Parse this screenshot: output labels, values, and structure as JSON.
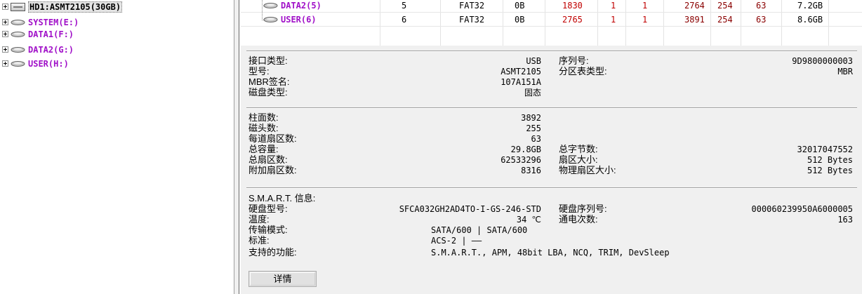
{
  "tree": {
    "disk_label": "HD1:ASMT2105(30GB)",
    "partitions": [
      "SYSTEM(E:)",
      "DATA1(F:)",
      "DATA2(G:)",
      "USER(H:)"
    ]
  },
  "partition_table": {
    "rows": [
      {
        "name": "DATA2(5)",
        "index": "5",
        "fs": "FAT32",
        "id": "0B",
        "start_cyl": "1830",
        "start_head": "1",
        "start_sector": "1",
        "end_cyl": "2764",
        "end_head": "254",
        "end_sector": "63",
        "size": "7.2GB"
      },
      {
        "name": "USER(6)",
        "index": "6",
        "fs": "FAT32",
        "id": "0B",
        "start_cyl": "2765",
        "start_head": "1",
        "start_sector": "1",
        "end_cyl": "3891",
        "end_head": "254",
        "end_sector": "63",
        "size": "8.6GB"
      }
    ]
  },
  "disk_info": {
    "interface_label": "接口类型:",
    "interface_value": "USB",
    "model_label": "型号:",
    "model_value": "ASMT2105",
    "mbr_sig_label": "MBR签名:",
    "mbr_sig_value": "107A151A",
    "disk_type_label": "磁盘类型:",
    "disk_type_value": "固态",
    "serial_label": "序列号:",
    "serial_value": "9D9800000003",
    "part_table_label": "分区表类型:",
    "part_table_value": "MBR"
  },
  "geometry": {
    "cylinders_label": "柱面数:",
    "cylinders_value": "3892",
    "heads_label": "磁头数:",
    "heads_value": "255",
    "spt_label": "每道扇区数:",
    "spt_value": "63",
    "capacity_label": "总容量:",
    "capacity_value": "29.8GB",
    "total_sectors_label": "总扇区数:",
    "total_sectors_value": "62533296",
    "extra_sectors_label": "附加扇区数:",
    "extra_sectors_value": "8316",
    "total_bytes_label": "总字节数:",
    "total_bytes_value": "32017047552",
    "sector_size_label": "扇区大小:",
    "sector_size_value": "512 Bytes",
    "physical_sector_label": "物理扇区大小:",
    "physical_sector_value": "512 Bytes"
  },
  "smart": {
    "header": "S.M.A.R.T. 信息:",
    "hdd_model_label": "硬盘型号:",
    "hdd_model_value": "SFCA032GH2AD4TO-I-GS-246-STD",
    "temp_label": "温度:",
    "temp_value": "34 ℃",
    "transfer_label": "传输模式:",
    "transfer_value": "SATA/600 | SATA/600",
    "standard_label": "标准:",
    "standard_value": "ACS-2 | ——",
    "features_label": "支持的功能:",
    "features_value": "S.M.A.R.T., APM, 48bit LBA, NCQ, TRIM, DevSleep",
    "hdd_serial_label": "硬盘序列号:",
    "hdd_serial_value": "000060239950A6000005",
    "power_on_label": "通电次数:",
    "power_on_value": "163"
  },
  "details_button": "详情"
}
